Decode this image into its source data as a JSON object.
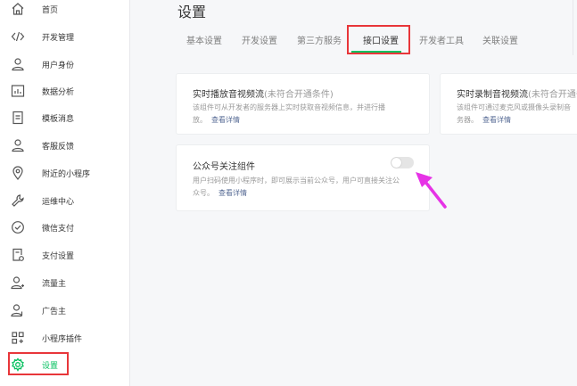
{
  "sidebar": {
    "items": [
      {
        "label": "首页",
        "icon": "home-icon"
      },
      {
        "label": "开发管理",
        "icon": "code-icon"
      },
      {
        "label": "用户身份",
        "icon": "user-icon"
      },
      {
        "label": "数据分析",
        "icon": "bar-chart-icon"
      },
      {
        "label": "模板消息",
        "icon": "document-icon"
      },
      {
        "label": "客服反馈",
        "icon": "service-user-icon"
      },
      {
        "label": "附近的小程序",
        "icon": "location-pin-icon"
      },
      {
        "label": "运维中心",
        "icon": "wrench-icon"
      },
      {
        "label": "微信支付",
        "icon": "wechat-pay-icon"
      },
      {
        "label": "支付设置",
        "icon": "payment-settings-icon"
      },
      {
        "label": "流量主",
        "icon": "traffic-user-icon"
      },
      {
        "label": "广告主",
        "icon": "advertiser-icon"
      },
      {
        "label": "小程序插件",
        "icon": "plugin-grid-icon"
      },
      {
        "label": "设置",
        "icon": "gear-icon",
        "active": true
      }
    ]
  },
  "main": {
    "title": "设置",
    "tabs": [
      "基本设置",
      "开发设置",
      "第三方服务",
      "接口设置",
      "开发者工具",
      "关联设置"
    ],
    "active_tab": "接口设置",
    "cards": {
      "realtime_play": {
        "title": "实时播放音视频流",
        "condition": "(未符合开通条件)",
        "desc_line1": "该组件可从开发者的服务器上实时获取音视频信息，并进行播",
        "desc_line2": "放。",
        "link": "查看详情"
      },
      "realtime_record": {
        "title": "实时录制音视频流",
        "condition": "(未符合开通条",
        "desc_line1": "该组件可通过麦克风或摄像头录制音",
        "desc_line2": "务器。",
        "link": "查看详情"
      },
      "official_account": {
        "title": "公众号关注组件",
        "desc_line1": "用户扫码使用小程序时，即可展示当前公众号，用户可直接关注公",
        "desc_line2": "众号。",
        "link": "查看详情",
        "toggle_on": false
      }
    }
  },
  "colors": {
    "accent_green": "#07c160",
    "highlight_red": "#e8363a",
    "arrow_magenta": "#e633e6",
    "link_blue": "#576b95"
  }
}
